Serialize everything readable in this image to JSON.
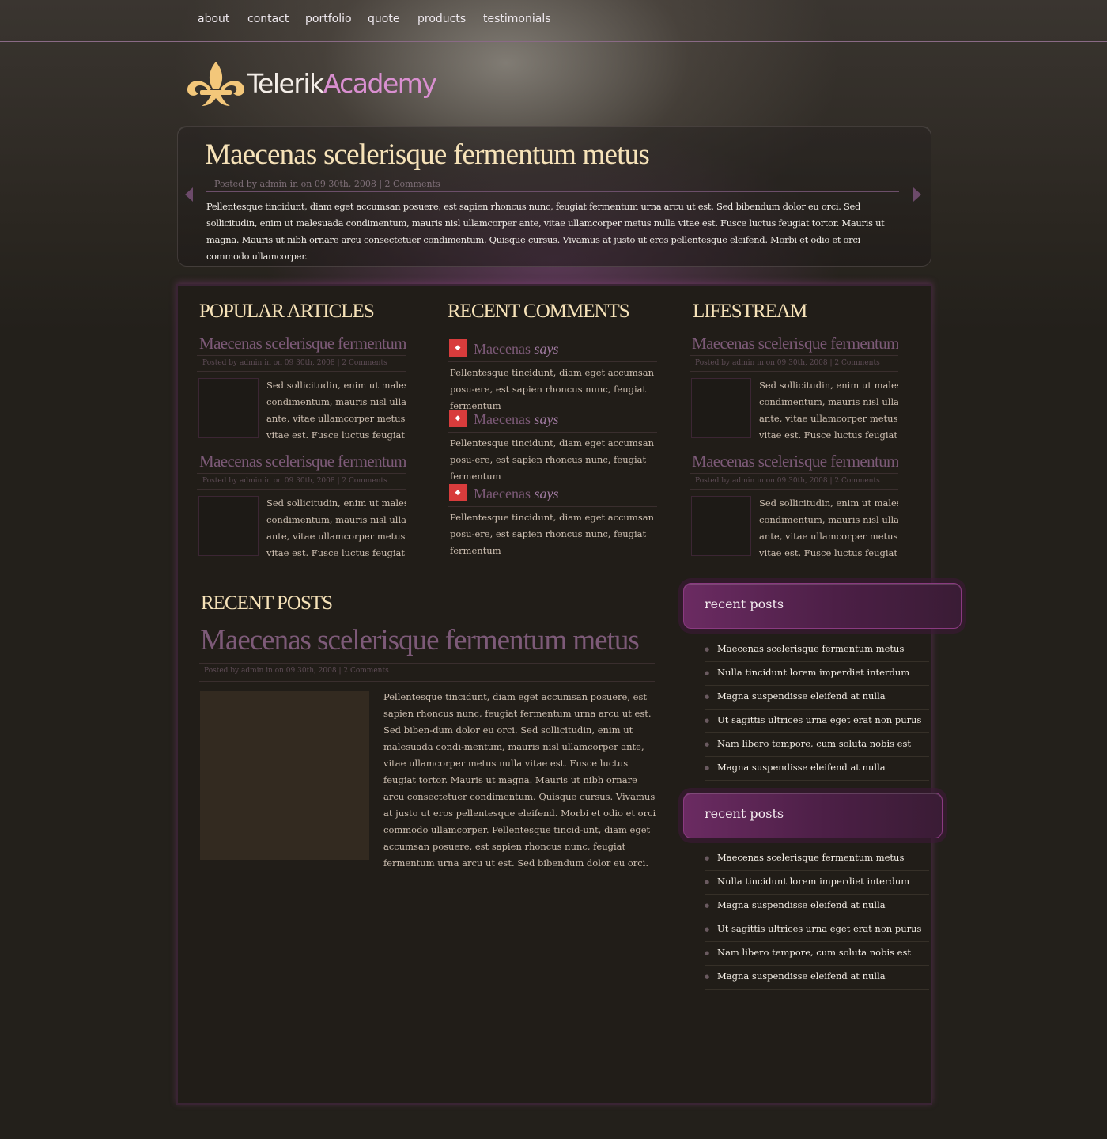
{
  "nav": {
    "items": [
      "about",
      "contact",
      "portfolio",
      "quote",
      "products",
      "testimonials"
    ]
  },
  "logo": {
    "word1": "Telerik",
    "word2": "Academy"
  },
  "feature": {
    "title": "Maecenas scelerisque fermentum metus",
    "meta": "Posted by admin in on 09 30th, 2008 | 2 Comments",
    "body": "Pellentesque tincidunt, diam eget accumsan posuere, est sapien rhoncus nunc, feugiat fermentum urna arcu ut est. Sed bibendum dolor eu orci. Sed sollicitudin, enim ut malesuada condimentum, mauris nisl ullamcorper ante, vitae ullamcorper metus nulla vitae est. Fusce luctus feugiat tortor. Mauris ut magna. Mauris ut nibh ornare arcu consectetuer condimentum. Quisque cursus. Vivamus at justo ut eros pellentesque eleifend. Morbi et odio et orci commodo ullamcorper."
  },
  "popular": {
    "title": "POPULAR ARTICLES",
    "articles": [
      {
        "title": "Maecenas scelerisque fermentum metus",
        "meta": "Posted by admin in on 09 30th, 2008 | 2 Comments",
        "lines": [
          "Sed sollicitudin, enim ut malesuada",
          "condimentum, mauris nisl ullamcorper",
          "ante, vitae ullamcorper metus nulla",
          "vitae est. Fusce luctus feugiat ..."
        ]
      },
      {
        "title": "Maecenas scelerisque fermentum metus",
        "meta": "Posted by admin in on 09 30th, 2008 | 2 Comments",
        "lines": [
          "Sed sollicitudin, enim ut malesuada",
          "condimentum, mauris nisl ullamcorper",
          "ante, vitae ullamcorper metus nulla",
          "vitae est. Fusce luctus feugiat ..."
        ]
      }
    ]
  },
  "comments": {
    "title": "RECENT COMMENTS",
    "items": [
      {
        "name": "Maecenas",
        "says": "says",
        "text": "Pellentesque tincidunt, diam eget accumsan posu-ere, est sapien rhoncus nunc, feugiat fermentum"
      },
      {
        "name": "Maecenas",
        "says": "says",
        "text": "Pellentesque tincidunt, diam eget accumsan posu-ere, est sapien rhoncus nunc, feugiat fermentum"
      },
      {
        "name": "Maecenas",
        "says": "says",
        "text": "Pellentesque tincidunt, diam eget accumsan posu-ere, est sapien rhoncus nunc, feugiat fermentum"
      }
    ]
  },
  "lifestream": {
    "title": "LIFESTREAM",
    "articles": [
      {
        "title": "Maecenas scelerisque fermentum metus",
        "meta": "Posted by admin in on 09 30th, 2008 | 2 Comments",
        "lines": [
          "Sed sollicitudin, enim ut malesuada",
          "condimentum, mauris nisl ullamcorper",
          "ante, vitae ullamcorper metus nulla",
          "vitae est. Fusce luctus feugiat ..."
        ]
      },
      {
        "title": "Maecenas scelerisque fermentum metus",
        "meta": "Posted by admin in on 09 30th, 2008 | 2 Comments",
        "lines": [
          "Sed sollicitudin, enim ut malesuada",
          "condimentum, mauris nisl ullamcorper",
          "ante, vitae ullamcorper metus nulla",
          "vitae est. Fusce luctus feugiat ..."
        ]
      }
    ]
  },
  "recent_posts": {
    "title": "RECENT POSTS",
    "post_title": "Maecenas scelerisque fermentum metus",
    "meta": "Posted by admin in on 09 30th, 2008 | 2 Comments",
    "text": "Pellentesque tincidunt, diam eget accumsan posuere, est sapien rhoncus nunc, feugiat fermentum urna arcu ut est. Sed biben-dum dolor eu orci. Sed sollicitudin, enim ut malesuada condi-mentum, mauris nisl ullamcorper ante, vitae ullamcorper metus nulla vitae est. Fusce luctus feugiat tortor. Mauris ut magna. Mauris ut nibh ornare arcu consectetuer condimentum. Quisque cursus. Vivamus at justo ut eros pellentesque eleifend. Morbi et odio et orci commodo ullamcorper. Pellentesque tincid-unt, diam eget accumsan posuere, est sapien rhoncus nunc, feugiat fermentum urna arcu ut est. Sed bibendum dolor eu orci."
  },
  "widgets": [
    {
      "title": "recent posts",
      "items": [
        "Maecenas scelerisque fermentum metus",
        "Nulla tincidunt lorem imperdiet interdum",
        "Magna suspendisse eleifend at nulla",
        "Ut sagittis ultrices urna eget erat non purus",
        "Nam libero tempore, cum soluta nobis est",
        "Magna suspendisse eleifend at nulla"
      ]
    },
    {
      "title": "recent posts",
      "items": [
        "Maecenas scelerisque fermentum metus",
        "Nulla tincidunt lorem imperdiet interdum",
        "Magna suspendisse eleifend at nulla",
        "Ut sagittis ultrices urna eget erat non purus",
        "Nam libero tempore, cum soluta nobis est",
        "Magna suspendisse eleifend at nulla"
      ]
    }
  ],
  "colors": {
    "accent": "#7d5a78",
    "heading": "#f6e2b8",
    "widget": "#6b2b62",
    "icon": "#d83c3c"
  }
}
